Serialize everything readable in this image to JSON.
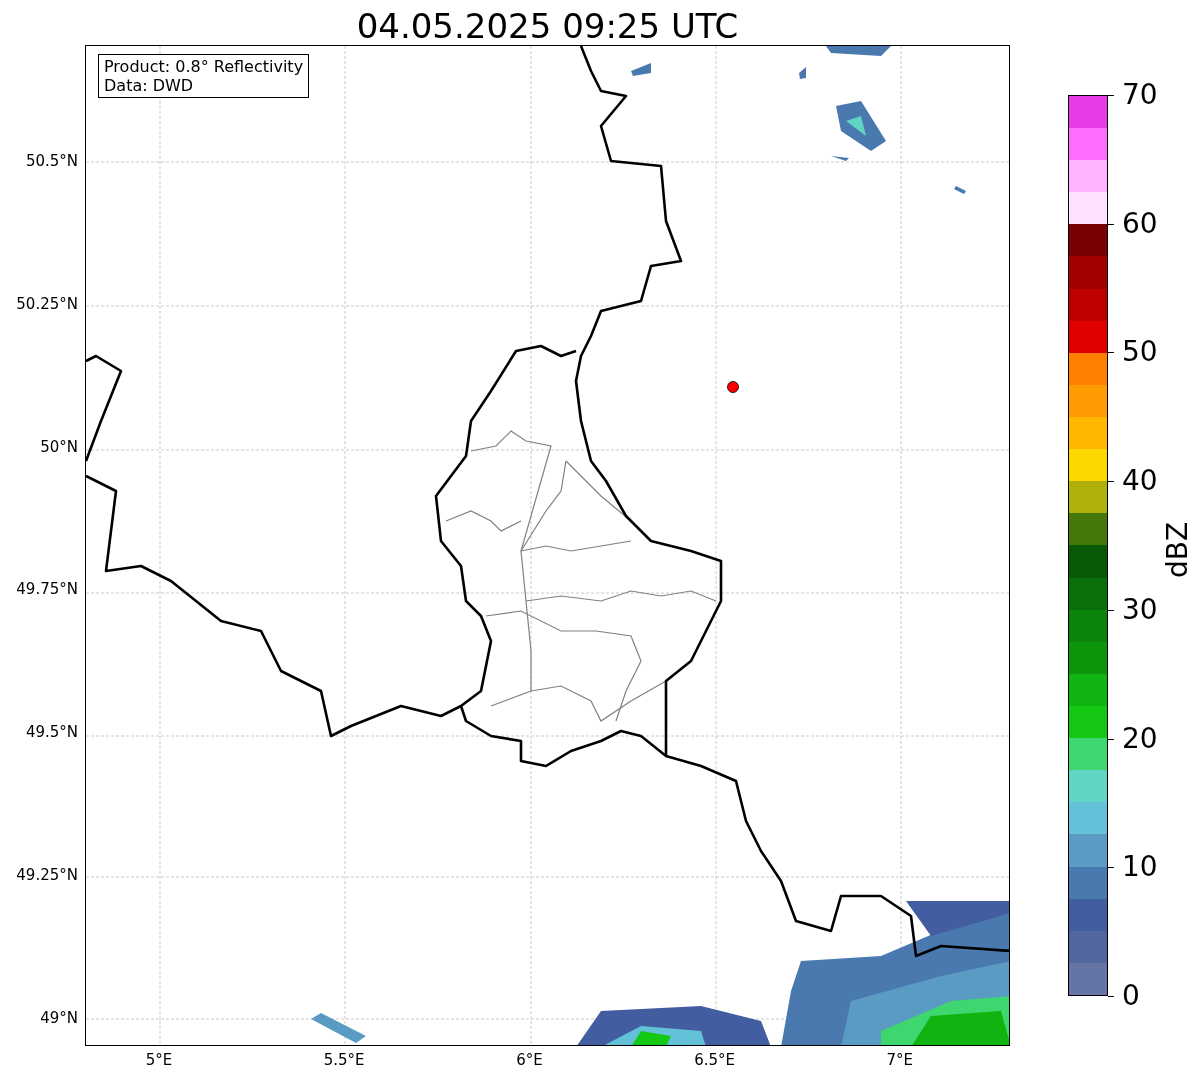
{
  "title": "04.05.2025 09:25 UTC",
  "legend": [
    "Product: 0.8° Reflectivity",
    "Data: DWD"
  ],
  "map": {
    "lat_ticks": [
      "50.5°N",
      "50.25°N",
      "50°N",
      "49.75°N",
      "49.5°N",
      "49.25°N",
      "49°N"
    ],
    "lon_ticks": [
      "5°E",
      "5.5°E",
      "6°E",
      "6.5°E",
      "7°E"
    ]
  },
  "colorbar": {
    "label": "dBZ",
    "ticks": [
      "70",
      "60",
      "50",
      "40",
      "30",
      "20",
      "10",
      "0"
    ],
    "bands": [
      {
        "color": "#6475a5"
      },
      {
        "color": "#52679e"
      },
      {
        "color": "#425ea0"
      },
      {
        "color": "#4a79b0"
      },
      {
        "color": "#5a9bc4"
      },
      {
        "color": "#64c2d8"
      },
      {
        "color": "#5fd6c4"
      },
      {
        "color": "#3ed66e"
      },
      {
        "color": "#14c814"
      },
      {
        "color": "#10b410"
      },
      {
        "color": "#0c960c"
      },
      {
        "color": "#0a840a"
      },
      {
        "color": "#0b700b"
      },
      {
        "color": "#085a08"
      },
      {
        "color": "#46780a"
      },
      {
        "color": "#b0b00a"
      },
      {
        "color": "#ffd700"
      },
      {
        "color": "#ffb700"
      },
      {
        "color": "#ff9a00"
      },
      {
        "color": "#ff7f00"
      },
      {
        "color": "#e10000"
      },
      {
        "color": "#c00000"
      },
      {
        "color": "#a00000"
      },
      {
        "color": "#780000"
      },
      {
        "color": "#ffe0ff"
      },
      {
        "color": "#ffb4ff"
      },
      {
        "color": "#ff6cff"
      },
      {
        "color": "#e83ae8"
      }
    ]
  }
}
